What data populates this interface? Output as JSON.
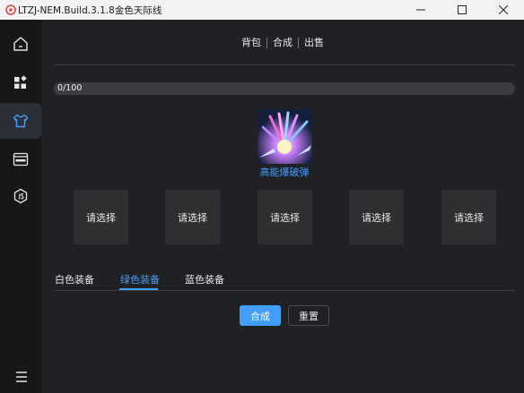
{
  "window": {
    "title": "LTZJ-NEM.Build.3.1.8金色天际线"
  },
  "sidebar": {
    "items": [
      {
        "icon": "home-icon"
      },
      {
        "icon": "apps-icon"
      },
      {
        "icon": "armor-icon",
        "active": true
      },
      {
        "icon": "http-icon"
      },
      {
        "icon": "js-icon"
      }
    ],
    "bottom_icon": "menu-icon"
  },
  "top_tabs": [
    {
      "label": "背包"
    },
    {
      "label": "合成"
    },
    {
      "label": "出售"
    }
  ],
  "progress": {
    "text": "0/100",
    "value": 0
  },
  "item": {
    "name": "高能爆破弹"
  },
  "slots": [
    {
      "label": "请选择"
    },
    {
      "label": "请选择"
    },
    {
      "label": "请选择"
    },
    {
      "label": "请选择"
    },
    {
      "label": "请选择"
    }
  ],
  "equip_tabs": [
    {
      "label": "白色装备"
    },
    {
      "label": "绿色装备",
      "active": true
    },
    {
      "label": "蓝色装备"
    }
  ],
  "buttons": {
    "synthesize": "合成",
    "reset": "重置"
  },
  "colors": {
    "accent": "#409eff",
    "background": "#202124",
    "sidebar": "#171717"
  }
}
